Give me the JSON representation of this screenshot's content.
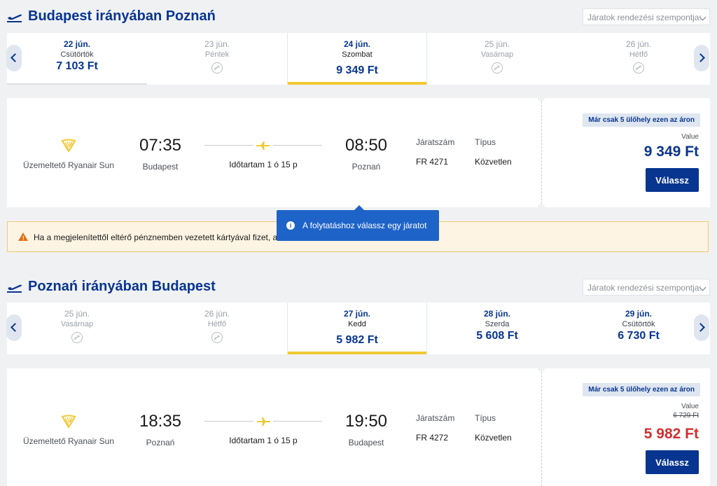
{
  "outbound": {
    "title": "Budapest irányában Poznań",
    "sort_placeholder": "Járatok rendezési szempontja:",
    "dates": [
      {
        "date": "22 jún.",
        "weekday": "Csütörtök",
        "price": "7 103 Ft",
        "state": "available"
      },
      {
        "date": "23 jún.",
        "weekday": "Péntek",
        "price": "",
        "state": "no-flight"
      },
      {
        "date": "24 jún.",
        "weekday": "Szombat",
        "price": "9 349 Ft",
        "state": "selected"
      },
      {
        "date": "25 jún.",
        "weekday": "Vasárnap",
        "price": "",
        "state": "no-flight"
      },
      {
        "date": "26 jún.",
        "weekday": "Hétfő",
        "price": "",
        "state": "no-flight"
      }
    ],
    "flight": {
      "operator": "Üzemeltető Ryanair Sun",
      "depart_time": "07:35",
      "depart_city": "Budapest",
      "duration": "Időtartam 1 ó 15 p",
      "arrive_time": "08:50",
      "arrive_city": "Poznań",
      "flight_no_label": "Járatszám",
      "flight_no": "FR 4271",
      "type_label": "Típus",
      "type": "Közvetlen",
      "badge": "Már csak 5 ülőhely ezen az áron",
      "fare_label": "Value",
      "old_price": "",
      "price": "9 349 Ft",
      "select_label": "Válassz"
    }
  },
  "warning_text": "Ha a megjelenítettől eltérő pénznemben vezetett kártyával fizet, a",
  "tooltip_text": "A folytatáshoz válassz egy járatot",
  "inbound": {
    "title": "Poznań irányában Budapest",
    "sort_placeholder": "Járatok rendezési szempontja:",
    "dates": [
      {
        "date": "25 jún.",
        "weekday": "Vasárnap",
        "price": "",
        "state": "no-flight"
      },
      {
        "date": "26 jún.",
        "weekday": "Hétfő",
        "price": "",
        "state": "no-flight"
      },
      {
        "date": "27 jún.",
        "weekday": "Kedd",
        "price": "5 982 Ft",
        "state": "selected"
      },
      {
        "date": "28 jún.",
        "weekday": "Szerda",
        "price": "5 608 Ft",
        "state": "available"
      },
      {
        "date": "29 jún.",
        "weekday": "Csütörtök",
        "price": "6 730 Ft",
        "state": "available"
      }
    ],
    "flight": {
      "operator": "Üzemeltető Ryanair Sun",
      "depart_time": "18:35",
      "depart_city": "Poznań",
      "duration": "Időtartam 1 ó 15 p",
      "arrive_time": "19:50",
      "arrive_city": "Budapest",
      "flight_no_label": "Járatszám",
      "flight_no": "FR 4272",
      "type_label": "Típus",
      "type": "Közvetlen",
      "badge": "Már csak 5 ülőhely ezen az áron",
      "fare_label": "Value",
      "old_price": "6 729 Ft",
      "price": "5 982 Ft",
      "select_label": "Válassz"
    }
  },
  "colors": {
    "brand": "#073590",
    "accent": "#f1c933",
    "sale": "#d32f2f",
    "tooltip": "#1e63c8",
    "warning": "#e0731a"
  }
}
